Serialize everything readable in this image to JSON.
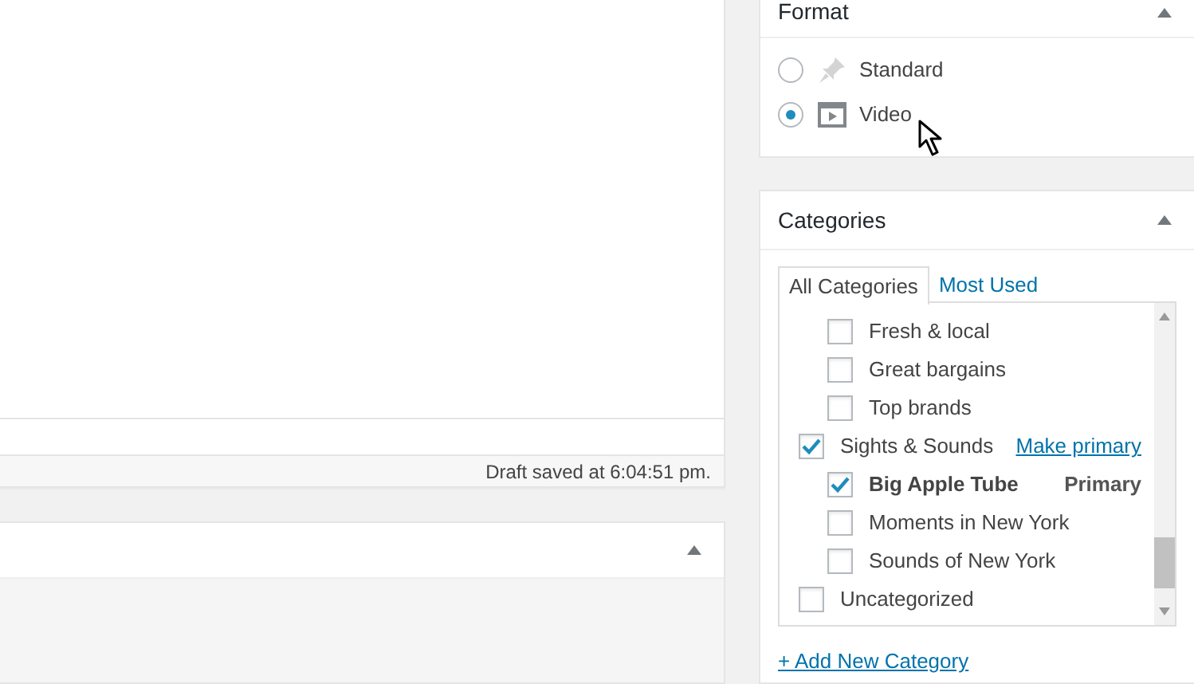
{
  "editor": {
    "status": "Draft saved at 6:04:51 pm."
  },
  "format_box": {
    "title": "Format",
    "options": [
      {
        "label": "Standard",
        "kind": "pin",
        "selected": false
      },
      {
        "label": "Video",
        "kind": "video",
        "selected": true
      }
    ]
  },
  "categories_box": {
    "title": "Categories",
    "tabs": [
      {
        "label": "All Categories",
        "selected": true
      },
      {
        "label": "Most Used",
        "selected": false
      }
    ],
    "items": [
      {
        "children": [
          {
            "label": "Fresh & local",
            "checked": false
          },
          {
            "label": "Great bargains",
            "checked": false
          },
          {
            "label": "Top brands",
            "checked": false
          }
        ]
      },
      {
        "label": "Sights & Sounds",
        "checked": true,
        "action": "Make primary",
        "children": [
          {
            "label": "Big Apple Tube",
            "checked": true,
            "primary": true,
            "badge": "Primary"
          },
          {
            "label": "Moments in New York",
            "checked": false
          },
          {
            "label": "Sounds of New York",
            "checked": false
          }
        ]
      },
      {
        "label": "Uncategorized",
        "checked": false
      }
    ],
    "add_link": "+ Add New Category"
  }
}
